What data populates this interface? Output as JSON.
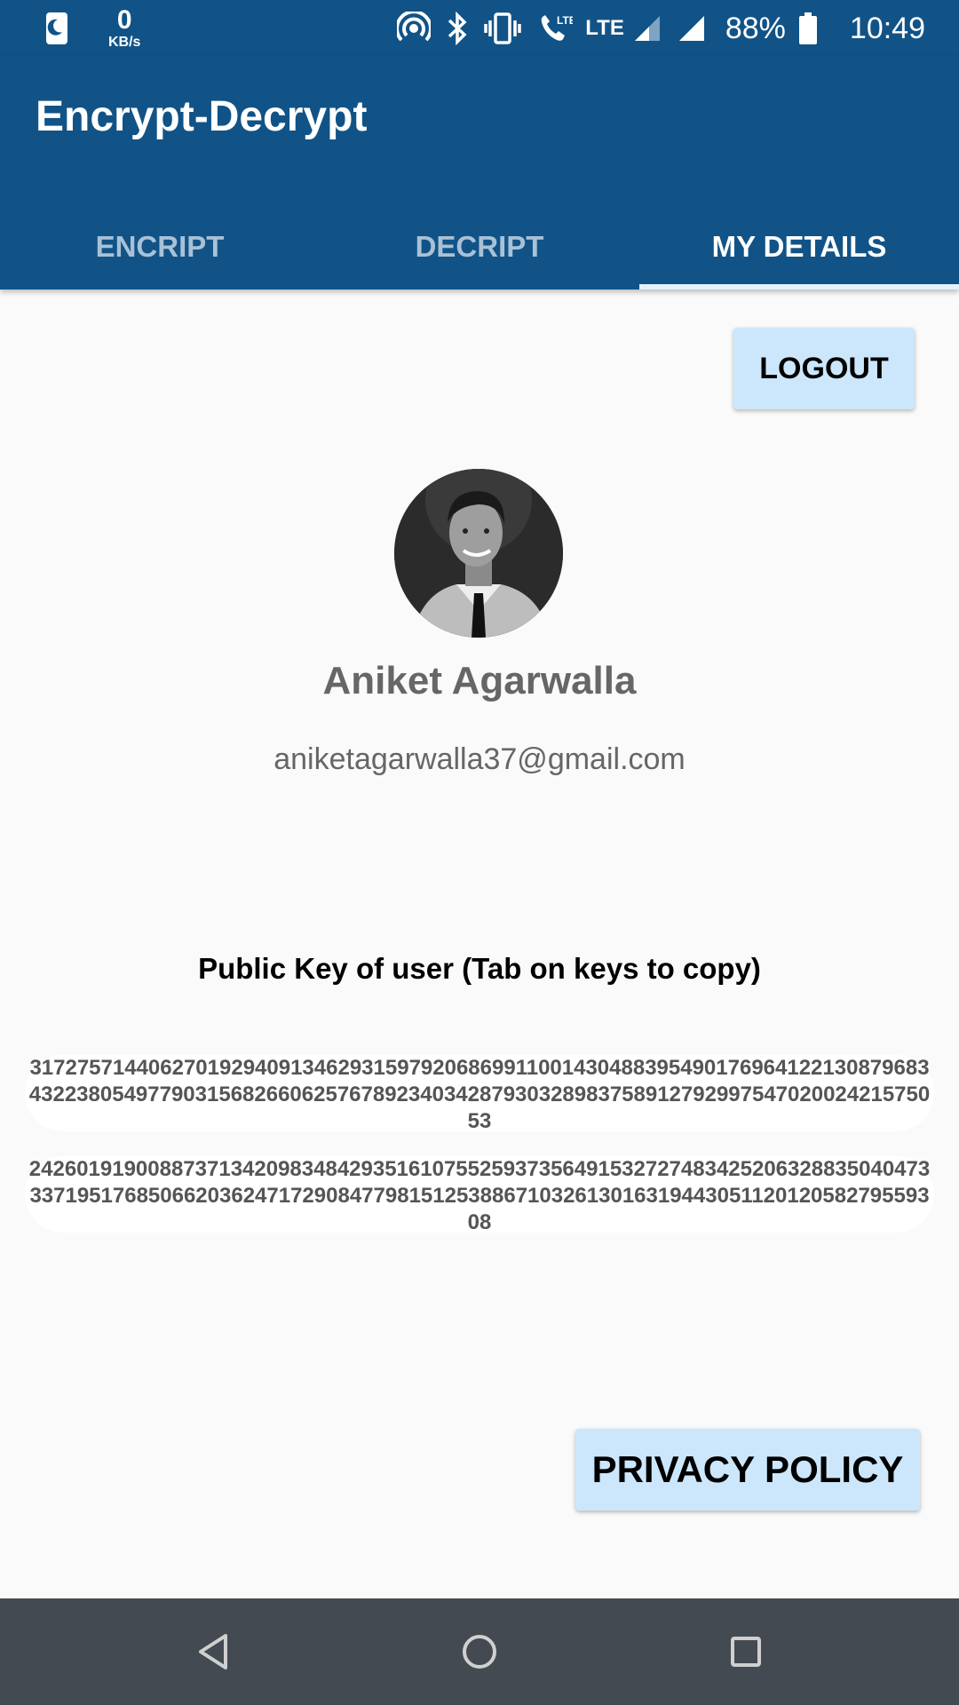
{
  "status_bar": {
    "speed_value": "0",
    "speed_unit": "KB/s",
    "network_labels": [
      "LTE",
      "LTE"
    ],
    "battery": "88%",
    "time": "10:49",
    "icons": [
      "night-mode-icon",
      "hotspot-icon",
      "bluetooth-icon",
      "vibrate-icon",
      "volte-call-icon",
      "signal-icon",
      "signal-icon",
      "battery-icon"
    ]
  },
  "app": {
    "title": "Encrypt-Decrypt",
    "color": "#115387"
  },
  "tabs": [
    {
      "label": "ENCRIPT",
      "active": false
    },
    {
      "label": "DECRIPT",
      "active": false
    },
    {
      "label": "MY DETAILS",
      "active": true
    }
  ],
  "actions": {
    "logout": "LOGOUT",
    "privacy": "PRIVACY POLICY"
  },
  "user": {
    "name": "Aniket Agarwalla",
    "email": "aniketagarwalla37@gmail.com"
  },
  "keys": {
    "heading": "Public Key of user (Tab on keys to copy)",
    "key1": "3172757144062701929409134629315979206869911001430488395490176964122130879683432238054977903156826606257678923403428793032898375891279299754702002421575053",
    "key2": "2426019190088737134209834842935161075525937356491532727483425206328835040473337195176850662036247172908477981512538867103261301631944305112012058279559308"
  },
  "nav": {
    "icons": [
      "back-icon",
      "home-icon",
      "recents-icon"
    ]
  }
}
